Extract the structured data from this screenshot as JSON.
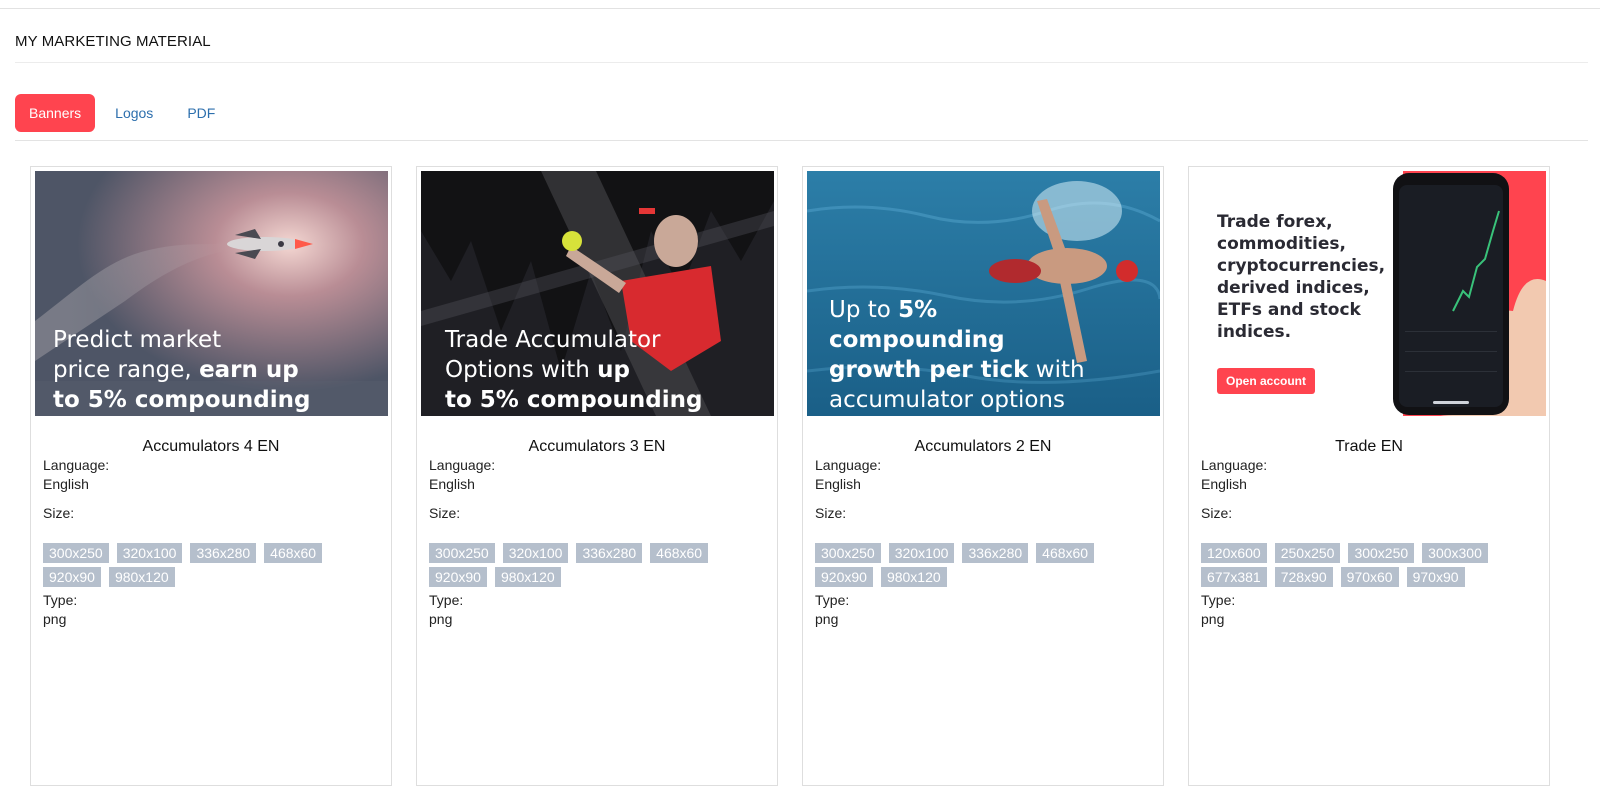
{
  "page": {
    "title": "MY MARKETING MATERIAL"
  },
  "tabs": [
    {
      "label": "Banners",
      "active": true
    },
    {
      "label": "Logos",
      "active": false
    },
    {
      "label": "PDF",
      "active": false
    }
  ],
  "labels": {
    "language": "Language:",
    "size": "Size:",
    "type": "Type:"
  },
  "cards": [
    {
      "title": "Accumulators 4 EN",
      "language": "English",
      "sizes": [
        "300x250",
        "320x100",
        "336x280",
        "468x60",
        "920x90",
        "980x120"
      ],
      "type": "png",
      "banner": {
        "line1": "Predict market",
        "line2a": "price range, ",
        "line2b": "earn up",
        "line3": "to 5% compounding"
      }
    },
    {
      "title": "Accumulators 3 EN",
      "language": "English",
      "sizes": [
        "300x250",
        "320x100",
        "336x280",
        "468x60",
        "920x90",
        "980x120"
      ],
      "type": "png",
      "banner": {
        "line1": "Trade Accumulator",
        "line2a": "Options with ",
        "line2b": "up",
        "line3": "to 5% compounding"
      }
    },
    {
      "title": "Accumulators 2 EN",
      "language": "English",
      "sizes": [
        "300x250",
        "320x100",
        "336x280",
        "468x60",
        "920x90",
        "980x120"
      ],
      "type": "png",
      "banner": {
        "line1a": "Up to ",
        "line1b": "5%",
        "line2": "compounding",
        "line3a": "growth per tick",
        "line3b": " with",
        "line4": "accumulator options"
      }
    },
    {
      "title": "Trade EN",
      "language": "English",
      "sizes": [
        "120x600",
        "250x250",
        "300x250",
        "300x300",
        "677x381",
        "728x90",
        "970x60",
        "970x90"
      ],
      "type": "png",
      "banner": {
        "text": "Trade forex, commodities, cryptocurrencies, derived indices, ETFs and stock indices.",
        "button": "Open account"
      }
    }
  ],
  "colors": {
    "accent": "#ff444f",
    "link": "#2d6fad",
    "chip": "#b5bfcc"
  }
}
